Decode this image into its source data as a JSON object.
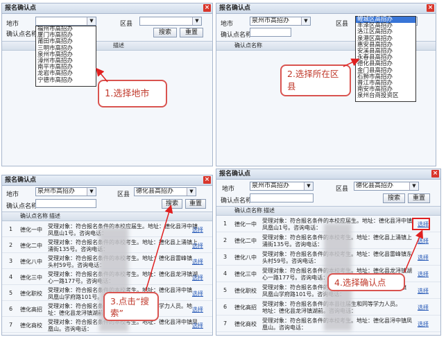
{
  "common": {
    "dialog_title": "报名确认点",
    "close": "×",
    "city_label": "地市",
    "district_label": "区县",
    "point_name_label": "确认点名称",
    "search_button": "搜索",
    "reset_button": "重置",
    "col_point_name": "确认点名称",
    "col_desc": "描述",
    "dropdown_arrow": "▼",
    "select_link": "选择"
  },
  "panel1": {
    "city_options": [
      "福州市高招办",
      "厦门市高招办",
      "莆田市高招办",
      "三明市高招办",
      "泉州市高招办",
      "漳州市高招办",
      "南平市高招办",
      "龙岩市高招办",
      "宁德市高招办"
    ],
    "callout": "1.选择地市"
  },
  "panel2": {
    "city_value": "泉州市高招办",
    "district_options": [
      "鲤城区高招办",
      "丰泽区高招办",
      "洛江区高招办",
      "泉港区高招办",
      "惠安县高招办",
      "安溪县高招办",
      "永春县高招办",
      "德化县高招办",
      "金门县高招办",
      "石狮市高招办",
      "晋江市高招办",
      "南安市高招办",
      "泉州台商投资区"
    ],
    "callout": "2.选择所在区县"
  },
  "panel3": {
    "city_value": "泉州市高招办",
    "district_value": "德化县高招办",
    "callout": "3.点击“搜索”"
  },
  "panel4": {
    "city_value": "泉州市高招办",
    "district_value": "德化县高招办",
    "callout": "4.选择确认点"
  },
  "rows3": [
    {
      "n": "1",
      "name": "德化一中",
      "l1": "受理对象：符合报名条件的本校应届生。地址：德化县浔中镇",
      "l2": "凤凰山1号。咨询电话："
    },
    {
      "n": "2",
      "name": "德化二中",
      "l1": "受理对象：符合报名条件的本校考生。地址：德化县上涌镇上",
      "l2": "涌街135号。咨询电话："
    },
    {
      "n": "3",
      "name": "德化八中",
      "l1": "受理对象：符合报名条件的本校考生。地址：德化县雷峰镇",
      "l2": "头村59号。咨询电话："
    },
    {
      "n": "4",
      "name": "德化三中",
      "l1": "受理对象：符合报名条件的本校考生。地址：德化县龙浔镇湖",
      "l2": "心一路177号。咨询电话："
    },
    {
      "n": "5",
      "name": "德化职校",
      "l1": "受理对象：符合报名条件的本校考生。地址：德化县浔中镇",
      "l2": "凤凰山学府路101号。咨询电话："
    },
    {
      "n": "6",
      "name": "德化高招",
      "l1": "受理对象：符合报名条件的本县往届生和同等学力人员。地",
      "l2": "址：德化县龙浔镇湖前。咨询电话："
    },
    {
      "n": "7",
      "name": "德化商校",
      "l1": "受理对象：符合报名条件的本校考生。地址：德化县浔中镇凤",
      "l2": "凰山。咨询电话："
    }
  ],
  "rows4": [
    {
      "n": "1",
      "name": "德化一中",
      "l1": "受理对象：符合报名条件的本校应届生。地址：德化县浔中镇",
      "l2": "凤凰山1号。咨询电话："
    },
    {
      "n": "2",
      "name": "德化二中",
      "l1": "受理对象：符合报名条件的本校考生。地址：德化县上涌镇上",
      "l2": "涌街135号。咨询电话："
    },
    {
      "n": "3",
      "name": "德化八中",
      "l1": "受理对象：符合报名条件的本校考生。地址：德化县雷峰镇东",
      "l2": "头村59号。咨询电话："
    },
    {
      "n": "4",
      "name": "德化三中",
      "l1": "受理对象：符合报名条件的本校考生。地址：德化县龙浔镇湖",
      "l2": "心一路177号。咨询电话："
    },
    {
      "n": "5",
      "name": "德化职校",
      "l1": "受理对象：符合报名条件的本校考生。地址：德化县浔中镇",
      "l2": "凤凰山学府路101号。咨询电话："
    },
    {
      "n": "6",
      "name": "德化高招",
      "l1": "受理对象：符合报名条件的本县往届生和同等学力人员。",
      "l2": "地址：德化县龙浔镇湖前。咨询电话："
    },
    {
      "n": "7",
      "name": "德化商校",
      "l1": "受理对象：符合报名条件的本校考生。地址：德化县浔中镇凤",
      "l2": "凰山。咨询电话："
    }
  ]
}
